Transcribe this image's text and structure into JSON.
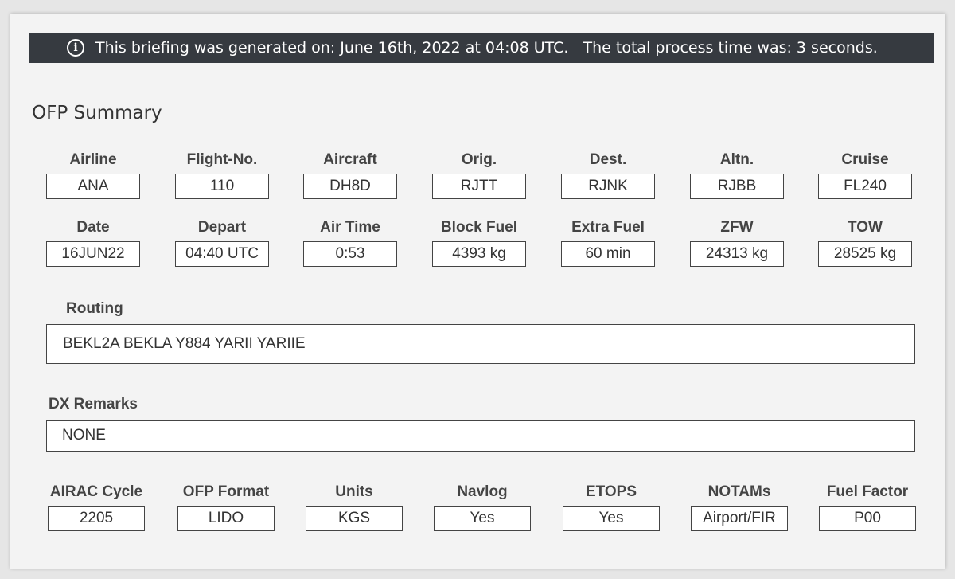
{
  "banner": {
    "icon": "info-icon",
    "text": "This briefing was generated on: June 16th, 2022 at 04:08 UTC.   The total process time was: 3 seconds."
  },
  "section_title": "OFP Summary",
  "row1": [
    {
      "label": "Airline",
      "value": "ANA"
    },
    {
      "label": "Flight-No.",
      "value": "110"
    },
    {
      "label": "Aircraft",
      "value": "DH8D"
    },
    {
      "label": "Orig.",
      "value": "RJTT"
    },
    {
      "label": "Dest.",
      "value": "RJNK"
    },
    {
      "label": "Altn.",
      "value": "RJBB"
    },
    {
      "label": "Cruise",
      "value": "FL240"
    }
  ],
  "row2": [
    {
      "label": "Date",
      "value": "16JUN22"
    },
    {
      "label": "Depart",
      "value": "04:40 UTC"
    },
    {
      "label": "Air Time",
      "value": "0:53"
    },
    {
      "label": "Block Fuel",
      "value": "4393 kg"
    },
    {
      "label": "Extra Fuel",
      "value": "60 min"
    },
    {
      "label": "ZFW",
      "value": "24313 kg"
    },
    {
      "label": "TOW",
      "value": "28525 kg"
    }
  ],
  "routing": {
    "label": "Routing",
    "value": "BEKL2A BEKLA Y884 YARII YARIIE"
  },
  "remarks": {
    "label": "DX Remarks",
    "value": "NONE"
  },
  "row3": [
    {
      "label": "AIRAC Cycle",
      "value": "2205"
    },
    {
      "label": "OFP Format",
      "value": "LIDO"
    },
    {
      "label": "Units",
      "value": "KGS"
    },
    {
      "label": "Navlog",
      "value": "Yes"
    },
    {
      "label": "ETOPS",
      "value": "Yes"
    },
    {
      "label": "NOTAMs",
      "value": "Airport/FIR"
    },
    {
      "label": "Fuel Factor",
      "value": "P00"
    }
  ]
}
